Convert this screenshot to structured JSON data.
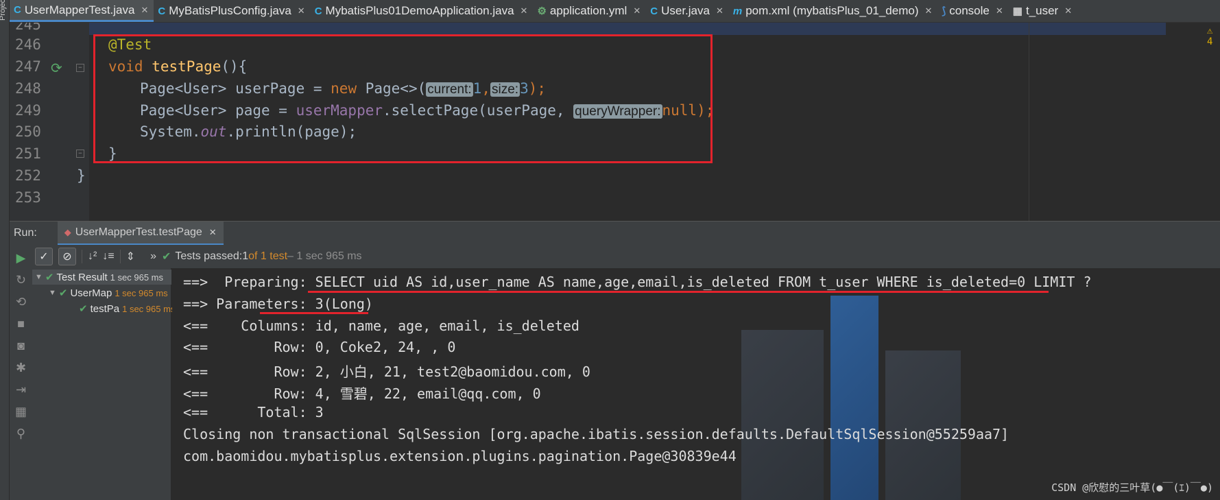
{
  "project_strip": {
    "label": "Project"
  },
  "tabs": [
    {
      "label": "UserMapperTest.java",
      "icon": "C",
      "active": true
    },
    {
      "label": "MyBatisPlusConfig.java",
      "icon": "C",
      "active": false
    },
    {
      "label": "MybatisPlus01DemoApplication.java",
      "icon": "C",
      "active": false
    },
    {
      "label": "application.yml",
      "icon": "⚙",
      "active": false
    },
    {
      "label": "User.java",
      "icon": "C",
      "active": false
    },
    {
      "label": "pom.xml (mybatisPlus_01_demo)",
      "icon": "m",
      "active": false
    },
    {
      "label": "console",
      "icon": "⟆",
      "active": false
    },
    {
      "label": "t_user",
      "icon": "▦",
      "active": false
    }
  ],
  "editor": {
    "line_numbers": [
      "245",
      "246",
      "247",
      "248",
      "249",
      "250",
      "251",
      "252",
      "253"
    ],
    "warning_count": "4",
    "code": {
      "l246": "@Test",
      "l247_kw": "void",
      "l247_fn": "testPage",
      "l247_rest": "(){",
      "l248_a": "Page<User> userPage = ",
      "l248_new": "new",
      "l248_b": " Page<>(",
      "l248_hint1": "current:",
      "l248_n1": "1",
      "l248_comma": ",",
      "l248_hint2": "size:",
      "l248_n2": "3",
      "l248_c": ");",
      "l249_a": "Page<User> page = ",
      "l249_field": "userMapper",
      "l249_b": ".selectPage(userPage, ",
      "l249_hint": "queryWrapper:",
      "l249_null": "null",
      "l249_c": ");",
      "l250_a": "System.",
      "l250_out": "out",
      "l250_b": ".println(page);",
      "l251": "}",
      "l252": "}"
    }
  },
  "run_panel": {
    "label": "Run:",
    "tab_label": "UserMapperTest.testPage",
    "status_passed": "Tests passed: ",
    "status_count": "1",
    "status_of": " of 1 test",
    "status_time": " – 1 sec 965 ms"
  },
  "tree": {
    "root": {
      "label": "Test Result",
      "time": "1 sec 965 ms"
    },
    "child": {
      "label": "UserMap",
      "time": "1 sec 965 ms"
    },
    "leaf": {
      "label": "testPa",
      "time": "1 sec 965 ms"
    }
  },
  "console": {
    "lines": [
      "==>  Preparing: SELECT uid AS id,user_name AS name,age,email,is_deleted FROM t_user WHERE is_deleted=0 LIMIT ?",
      "==> Parameters: 3(Long)",
      "<==    Columns: id, name, age, email, is_deleted",
      "<==        Row: 0, Coke2, 24, , 0",
      "<==        Row: 2, 小白, 21, test2@baomidou.com, 0",
      "<==        Row: 4, 雪碧, 22, email@qq.com, 0",
      "<==      Total: 3",
      "Closing non transactional SqlSession [org.apache.ibatis.session.defaults.DefaultSqlSession@55259aa7]",
      "com.baomidou.mybatisplus.extension.plugins.pagination.Page@30839e44"
    ],
    "watermark": "CSDN @欣慰的三叶草(●￣(ｴ)￣●)"
  },
  "colors": {
    "highlight_box": "#e3232c",
    "accent": "#4a88c7",
    "pass": "#59a869"
  }
}
